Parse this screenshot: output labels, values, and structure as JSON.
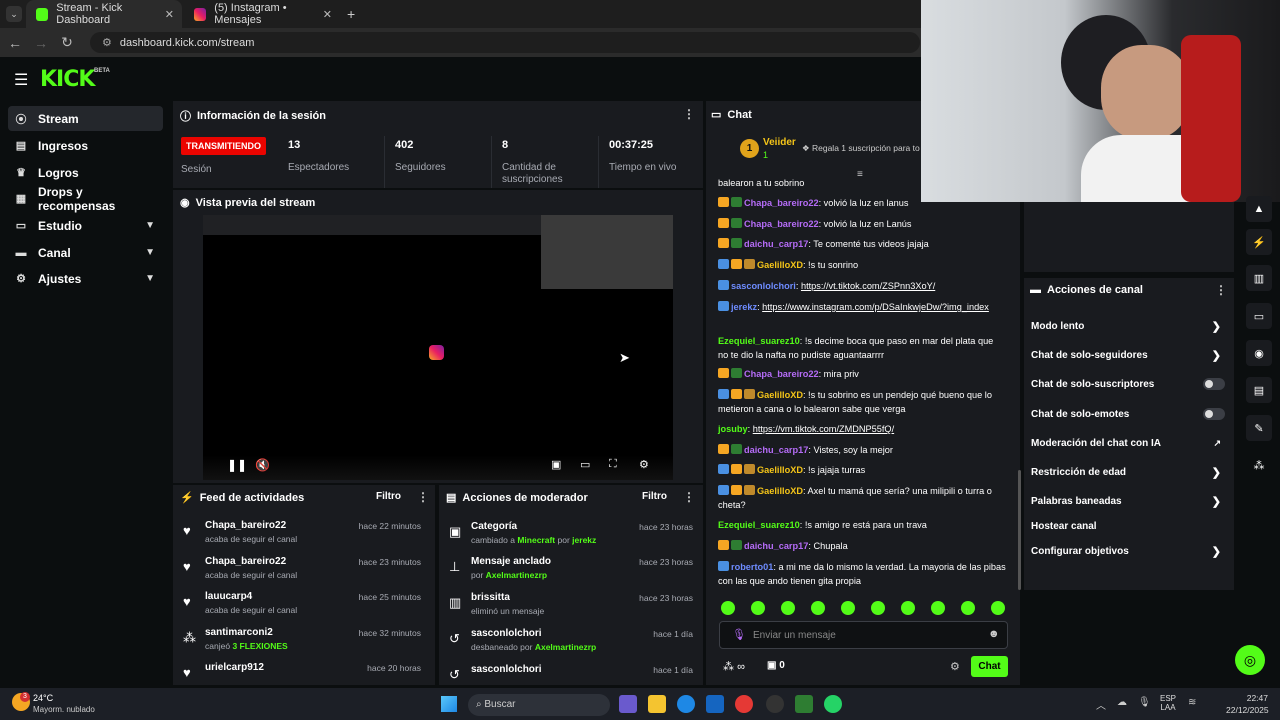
{
  "browser": {
    "tabs": [
      {
        "title": "Stream - Kick Dashboard"
      },
      {
        "title": "(5) Instagram • Mensajes"
      }
    ],
    "url": "dashboard.kick.com/stream"
  },
  "app": {
    "logo": "KICK",
    "beta": "BETA"
  },
  "sidebar": {
    "items": [
      {
        "label": "Stream",
        "icon": "stream-icon"
      },
      {
        "label": "Ingresos",
        "icon": "dollar-icon"
      },
      {
        "label": "Logros",
        "icon": "trophy-icon"
      },
      {
        "label": "Drops y recompensas",
        "icon": "gift-icon"
      },
      {
        "label": "Estudio",
        "icon": "studio-icon"
      },
      {
        "label": "Canal",
        "icon": "channel-icon"
      },
      {
        "label": "Ajustes",
        "icon": "gear-icon"
      }
    ]
  },
  "session": {
    "title": "Información de la sesión",
    "status": "TRANSMITIENDO",
    "status_label": "Sesión",
    "stats": [
      {
        "value": "13",
        "label": "Espectadores"
      },
      {
        "value": "402",
        "label": "Seguidores"
      },
      {
        "value": "8",
        "label": "Cantidad de suscripciones"
      },
      {
        "value": "00:37:25",
        "label": "Tiempo en vivo"
      }
    ]
  },
  "preview": {
    "title": "Vista previa del stream"
  },
  "feed": {
    "title": "Feed de actividades",
    "filter": "Filtro",
    "items": [
      {
        "name": "Chapa_bareiro22",
        "desc": "acaba de seguir el canal",
        "time": "hace 22 minutos"
      },
      {
        "name": "Chapa_bareiro22",
        "desc": "acaba de seguir el canal",
        "time": "hace 23 minutos"
      },
      {
        "name": "lauucarp4",
        "desc": "acaba de seguir el canal",
        "time": "hace 25 minutos"
      },
      {
        "name": "santimarconi2",
        "desc": "canjeó",
        "highlight": "3 FLEXIONES",
        "time": "hace 32 minutos"
      },
      {
        "name": "urielcarp912",
        "desc": "",
        "time": "hace 20 horas"
      }
    ]
  },
  "mod": {
    "title": "Acciones de moderador",
    "filter": "Filtro",
    "items": [
      {
        "name": "Categoría",
        "desc": "cambiado a",
        "hl": "Minecraft",
        "by": "por",
        "hl2": "jerekz",
        "time": "hace 23 horas"
      },
      {
        "name": "Mensaje anclado",
        "desc": "por",
        "hl": "Axelmartinezrp",
        "by": "",
        "hl2": "",
        "time": "hace 23 horas"
      },
      {
        "name": "brissitta",
        "desc": "eliminó un mensaje",
        "hl": "",
        "by": "",
        "hl2": "",
        "time": "hace 23 horas"
      },
      {
        "name": "sasconlolchori",
        "desc": "desbaneado por",
        "hl": "Axelmartinezrp",
        "by": "",
        "hl2": "",
        "time": "hace 1 día"
      },
      {
        "name": "sasconlolchori",
        "desc": "",
        "hl": "",
        "by": "",
        "hl2": "",
        "time": "hace 1 día"
      }
    ]
  },
  "chat": {
    "title": "Chat",
    "pinned_user": "Veiider",
    "pinned_rank": "1",
    "pinned_sub": "1",
    "gift_text": "Regala 1 suscripción para to",
    "top_fragment": "balearon a tu sobrino",
    "messages": [
      {
        "user": "Chapa_bareiro22",
        "color": "#b56cf7",
        "text": ": volvió la luz en lanus",
        "link": ""
      },
      {
        "user": "Chapa_bareiro22",
        "color": "#b56cf7",
        "text": ": volvió la luz en Lanús",
        "link": ""
      },
      {
        "user": "daichu_carp17",
        "color": "#b56cf7",
        "text": ": Te comenté tus videos jajaja",
        "link": ""
      },
      {
        "user": "GaelilloXD",
        "color": "#f5c518",
        "text": ": !s tu sonrino",
        "link": ""
      },
      {
        "user": "sasconlolchori",
        "color": "#6e8cff",
        "text": ": ",
        "link": "https://vt.tiktok.com/ZSPnn3XoY/"
      },
      {
        "user": "jerekz",
        "color": "#6e8cff",
        "text": ": ",
        "link": "https://www.instagram.com/p/DSaInkwjeDw/?img_index"
      },
      {
        "user": "Ezequiel_suarez10",
        "color": "#53fc18",
        "text": ": !s decime boca que paso en mar del plata que no te dio la nafta no pudiste aguantaarrrr",
        "link": ""
      },
      {
        "user": "Chapa_bareiro22",
        "color": "#b56cf7",
        "text": ": mira priv",
        "link": ""
      },
      {
        "user": "GaelilloXD",
        "color": "#f5c518",
        "text": ": !s tu sobrino es un pendejo qué bueno que lo metieron a cana o lo balearon sabe que verga",
        "link": ""
      },
      {
        "user": "josuby",
        "color": "#53fc18",
        "text": ": ",
        "link": "https://vm.tiktok.com/ZMDNP55fQ/"
      },
      {
        "user": "daichu_carp17",
        "color": "#b56cf7",
        "text": ": Vistes, soy la mejor",
        "link": ""
      },
      {
        "user": "GaelilloXD",
        "color": "#f5c518",
        "text": ": !s jajaja turras",
        "link": ""
      },
      {
        "user": "GaelilloXD",
        "color": "#f5c518",
        "text": ": Axel tu mamá que sería? una milipili o turra o cheta?",
        "link": ""
      },
      {
        "user": "Ezequiel_suarez10",
        "color": "#53fc18",
        "text": ": !s amigo re está para un trava",
        "link": ""
      },
      {
        "user": "daichu_carp17",
        "color": "#b56cf7",
        "text": ": Chupala",
        "link": ""
      },
      {
        "user": "roberto01",
        "color": "#6e8cff",
        "text": ": a mi me da lo mismo la verdad. La mayoria de las pibas con las que ando tienen gita propia",
        "link": ""
      }
    ],
    "input_placeholder": "Enviar un mensaje",
    "points": "∞",
    "count": "0",
    "send": "Chat"
  },
  "actions": {
    "title": "Acciones de canal",
    "items": [
      {
        "label": "Modo lento",
        "type": "chevron"
      },
      {
        "label": "Chat de solo-seguidores",
        "type": "chevron"
      },
      {
        "label": "Chat de solo-suscriptores",
        "type": "toggle"
      },
      {
        "label": "Chat de solo-emotes",
        "type": "toggle"
      },
      {
        "label": "Moderación del chat con IA",
        "type": "external"
      },
      {
        "label": "Restricción de edad",
        "type": "chevron"
      },
      {
        "label": "Palabras baneadas",
        "type": "chevron"
      },
      {
        "label": "Hostear canal",
        "type": "none"
      },
      {
        "label": "Configurar objetivos",
        "type": "chevron"
      }
    ]
  },
  "taskbar": {
    "weather_temp": "24°C",
    "weather_desc": "Mayorm. nublado",
    "weather_badge": "3",
    "search": "Buscar",
    "lang": "ESP",
    "region": "LAA",
    "time": "22:47",
    "date": "22/12/2025"
  },
  "colors": {
    "accent": "#53fc18",
    "live": "#eb0400",
    "panel": "#191b1f",
    "bg": "#0b0e0f"
  }
}
